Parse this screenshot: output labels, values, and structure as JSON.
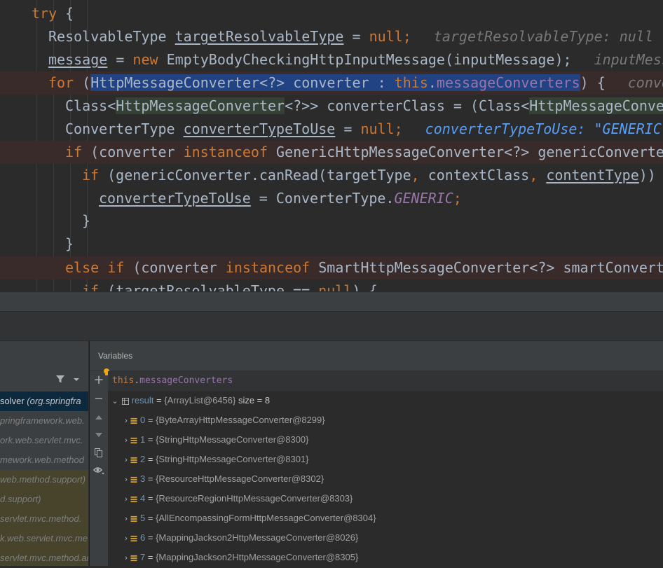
{
  "editor": {
    "line1": {
      "kw": "try",
      "rest": " {"
    },
    "line2": {
      "type": "ResolvableType ",
      "var": "targetResolvableType",
      "eq": " = ",
      "null": "null",
      "semi": ";",
      "hint": "targetResolvableType: null"
    },
    "line3": {
      "var": "message",
      "eq": " = ",
      "kw_new": "new",
      "rest": " EmptyBodyCheckingHttpInputMessage(inputMessage);",
      "hint": "inputMess"
    },
    "line4": {
      "kw": "for",
      "open": " (",
      "sel1": "HttpMessageConverter<?> converter : ",
      "sel_this": "this",
      "sel_dot": ".",
      "sel_field": "messageConverters",
      "close": ") {",
      "hint": "conve"
    },
    "line5": {
      "a": "Class<",
      "b": "HttpMessageConverter",
      "c": "<?>> converterClass = (Class<",
      "d": "HttpMessageConve"
    },
    "line6": {
      "type": "ConverterType ",
      "var": "converterTypeToUse",
      "eq": " = ",
      "null": "null",
      "semi": ";",
      "hint": "converterTypeToUse: \"GENERIC\""
    },
    "line7": {
      "kw": "if",
      "a": " (converter ",
      "kw2": "instanceof",
      "b": " GenericHttpMessageConverter<?> genericConverte"
    },
    "line8": {
      "kw": "if",
      "a": " (genericConverter.canRead(targetType",
      "comma1": ",",
      "b": " contextClass",
      "comma2": ",",
      "c": " ",
      "var": "contentType",
      "d": "))"
    },
    "line9": {
      "var": "converterTypeToUse",
      "a": " = ConverterType.",
      "const": "GENERIC",
      "semi": ";"
    },
    "line10": {
      "text": "}"
    },
    "line11": {
      "text": "}"
    },
    "line12": {
      "kw": "else if",
      "a": " (converter ",
      "kw2": "instanceof",
      "b": " SmartHttpMessageConverter<?> smartConvert"
    },
    "line13": {
      "kw": "if",
      "a": " (",
      "var": "targetResolvableType",
      "b": " == ",
      "null": "null",
      "c": ") {"
    }
  },
  "frames": {
    "items": [
      {
        "name": "solver",
        "pkg": " (org.springfra"
      },
      {
        "text": "pringframework.web."
      },
      {
        "text": "ork.web.servlet.mvc."
      },
      {
        "text": "mework.web.method"
      },
      {
        "text": "web.method.support)"
      },
      {
        "text": "d.support)"
      },
      {
        "text": "servlet.mvc.method."
      },
      {
        "text": "k.web.servlet.mvc.me"
      },
      {
        "text": "servlet.mvc.method.an"
      }
    ]
  },
  "variables": {
    "title": "Variables",
    "watch": {
      "this": "this",
      "dot": ".",
      "field": "messageConverters"
    },
    "result": {
      "name": "result",
      "eq": " = ",
      "value": "{ArrayList@6456}",
      "size": "  size = 8"
    },
    "items": [
      {
        "idx": "0",
        "eq": " = ",
        "value": "{ByteArrayHttpMessageConverter@8299}"
      },
      {
        "idx": "1",
        "eq": " = ",
        "value": "{StringHttpMessageConverter@8300}"
      },
      {
        "idx": "2",
        "eq": " = ",
        "value": "{StringHttpMessageConverter@8301}"
      },
      {
        "idx": "3",
        "eq": " = ",
        "value": "{ResourceHttpMessageConverter@8302}"
      },
      {
        "idx": "4",
        "eq": " = ",
        "value": "{ResourceRegionHttpMessageConverter@8303}"
      },
      {
        "idx": "5",
        "eq": " = ",
        "value": "{AllEncompassingFormHttpMessageConverter@8304}"
      },
      {
        "idx": "6",
        "eq": " = ",
        "value": "{MappingJackson2HttpMessageConverter@8026}"
      },
      {
        "idx": "7",
        "eq": " = ",
        "value": "{MappingJackson2HttpMessageConverter@8305}"
      }
    ]
  },
  "icons": {
    "add": "plus-icon",
    "remove": "minus-icon",
    "up": "arrow-up-icon",
    "down": "arrow-down-icon",
    "copy": "copy-icon",
    "watch": "eye-icon",
    "filter": "filter-icon",
    "bulb": "lightbulb-icon",
    "table": "table-icon",
    "field": "field-icon"
  },
  "colors": {
    "editor_bg": "#2b2b2b",
    "keyword": "#cc7832",
    "field": "#9876aa",
    "selection": "#214283",
    "hint_blue": "#589df6"
  }
}
